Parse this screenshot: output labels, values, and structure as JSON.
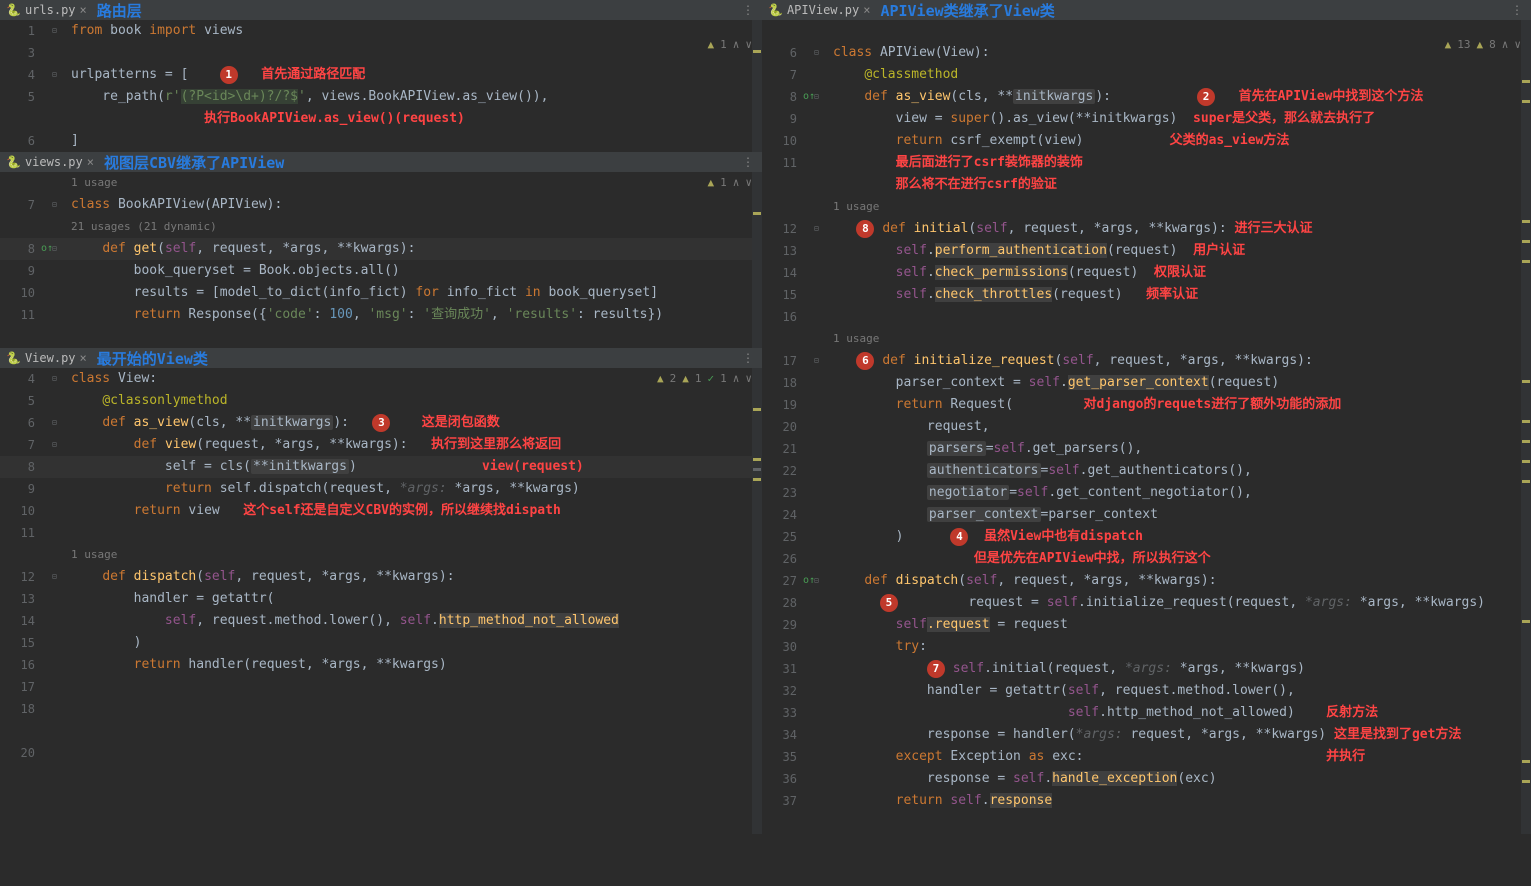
{
  "panes": {
    "urls": {
      "file": "urls.py",
      "title": "路由层",
      "status": "1",
      "lines": {
        "1": [
          {
            "c": "kw",
            "t": "from "
          },
          {
            "c": "",
            "t": "book "
          },
          {
            "c": "kw",
            "t": "import "
          },
          {
            "c": "",
            "t": "views"
          }
        ],
        "4_1": "urlpatterns = [",
        "4_ann": "首先通过路径匹配",
        "5_1": "    re_path(",
        "5_2": "r'",
        "5_3": "(?P<id>\\d+)?/?$",
        "5_4": "'",
        "5_5": ", views.BookAPIView.as_view()),",
        "5_ann": "执行BookAPIView.as_view()(request)",
        "6_1": "]"
      }
    },
    "views": {
      "file": "views.py",
      "title": "视图层CBV继承了APIView",
      "status": "1",
      "usage1": "1 usage",
      "lines": {
        "7": [
          {
            "c": "kw",
            "t": "class "
          },
          {
            "c": "class-name",
            "t": "BookAPIView(APIView):"
          }
        ],
        "usage2": "21 usages (21 dynamic)",
        "8": [
          {
            "c": "",
            "t": "    "
          },
          {
            "c": "kw",
            "t": "def "
          },
          {
            "c": "def",
            "t": "get"
          },
          {
            "c": "",
            "t": "("
          },
          {
            "c": "self",
            "t": "self"
          },
          {
            "c": "",
            "t": ", request, *args, **kwargs):"
          }
        ],
        "9": "        book_queryset = Book.objects.all()",
        "10_1": "        results = [model_to_dict(info_fict) ",
        "10_2": "for ",
        "10_3": "info_fict ",
        "10_4": "in ",
        "10_5": "book_queryset]",
        "11_1": "        ",
        "11_2": "return ",
        "11_3": "Response({",
        "11_4": "'code'",
        "11_5": ": ",
        "11_6": "100",
        "11_7": ", ",
        "11_8": "'msg'",
        "11_9": ": ",
        "11_10": "'查询成功'",
        "11_11": ", ",
        "11_12": "'results'",
        "11_13": ": results})"
      }
    },
    "view": {
      "file": "View.py",
      "title": "最开始的View类",
      "status_warn": "2",
      "status_err": "1",
      "status_chk": "1",
      "lines": {
        "4": [
          {
            "c": "kw",
            "t": "class "
          },
          {
            "c": "class-name",
            "t": "View:"
          }
        ],
        "5": [
          {
            "c": "",
            "t": "    "
          },
          {
            "c": "decorator",
            "t": "@classonlymethod"
          }
        ],
        "6_1": "    ",
        "6_2": "def ",
        "6_3": "as_view",
        "6_4": "(cls, **",
        "6_5": "initkwargs",
        "6_6": "):",
        "6_ann1": "这是闭包函数",
        "6_ann2": "执行到这里那么将返回",
        "6_ann3": "view(request)",
        "7_1": "        ",
        "7_2": "def ",
        "7_3": "view",
        "7_4": "(request, *args, **kwargs):",
        "8_1": "            self = cls(",
        "8_2": "**initkwargs",
        "8_3": ")",
        "9_1": "            ",
        "9_2": "return ",
        "9_3": "self.dispatch(request, ",
        "9_4": "*args: ",
        "9_5": "*args, **kwargs)",
        "10_1": "        ",
        "10_2": "return ",
        "10_3": "view",
        "10_ann": "这个self还是自定义CBV的实例，所以继续找dispath",
        "usage": "1 usage",
        "12_1": "    ",
        "12_2": "def ",
        "12_3": "dispatch",
        "12_4": "(",
        "12_5": "self",
        "12_6": ", request, *args, **kwargs):",
        "13": "        handler = getattr(",
        "14_1": "            ",
        "14_2": "self",
        "14_3": ", request.method.lower(), ",
        "14_4": "self",
        "14_5": ".",
        "14_6": "http_method_not_allowed",
        "15": "        )",
        "16_1": "        ",
        "16_2": "return ",
        "16_3": "handler(request, *args, **kwargs)"
      }
    },
    "apiview": {
      "file": "APIView.py",
      "title": "APIView类继承了View类",
      "status_warn": "13",
      "status_err": "8",
      "usage1": "1 usage",
      "usage2": "1 usage",
      "lines": {
        "6": [
          {
            "c": "kw",
            "t": "class "
          },
          {
            "c": "class-name",
            "t": "APIView(View):"
          }
        ],
        "7": [
          {
            "c": "",
            "t": "    "
          },
          {
            "c": "decorator",
            "t": "@classmethod"
          }
        ],
        "8_1": "    ",
        "8_2": "def ",
        "8_3": "as_view",
        "8_4": "(cls, **",
        "8_5": "initkwargs",
        "8_6": "):",
        "8_ann": "首先在APIView中找到这个方法",
        "9_1": "        view = ",
        "9_2": "super",
        "9_3": "().as_view(**initkwargs)",
        "9_ann1": "super是父类，那么就去执行了",
        "9_ann2": "父类的as_view方法",
        "10_1": "        ",
        "10_2": "return ",
        "10_3": "csrf_exempt(view)",
        "10_ann1": "最后面进行了csrf装饰器的装饰",
        "10_ann2": "那么将不在进行csrf的验证",
        "12_1": "    ",
        "12_2": "def ",
        "12_3": "initial",
        "12_4": "(",
        "12_5": "self",
        "12_6": ", request, *args, **kwargs):",
        "12_ann": "进行三大认证",
        "13_1": "        ",
        "13_2": "self",
        "13_3": ".",
        "13_4": "perform_authentication",
        "13_5": "(request)",
        "13_ann": "用户认证",
        "14_1": "        ",
        "14_2": "self",
        "14_3": ".",
        "14_4": "check_permissions",
        "14_5": "(request)",
        "14_ann": "权限认证",
        "15_1": "        ",
        "15_2": "self",
        "15_3": ".",
        "15_4": "check_throttles",
        "15_5": "(request)",
        "15_ann": "频率认证",
        "17_1": "    ",
        "17_2": "def ",
        "17_3": "initialize_request",
        "17_4": "(",
        "17_5": "self",
        "17_6": ", request, *args, **kwargs):",
        "18_1": "        parser_context = ",
        "18_2": "self",
        "18_3": ".",
        "18_4": "get_parser_context",
        "18_5": "(request)",
        "19_1": "        ",
        "19_2": "return ",
        "19_3": "Request(",
        "19_ann": "对django的requets进行了额外功能的添加",
        "20": "            request,",
        "21_1": "            ",
        "21_2": "parsers",
        "21_3": "=",
        "21_4": "self",
        "21_5": ".get_parsers(),",
        "22_1": "            ",
        "22_2": "authenticators",
        "22_3": "=",
        "22_4": "self",
        "22_5": ".get_authenticators(),",
        "23_1": "            ",
        "23_2": "negotiator",
        "23_3": "=",
        "23_4": "self",
        "23_5": ".get_content_negotiator(),",
        "24_1": "            ",
        "24_2": "parser_context",
        "24_3": "=parser_context",
        "25": "        )",
        "25_ann1": "虽然View中也有dispatch",
        "25_ann2": "但是优先在APIView中找，所以执行这个",
        "27_1": "    ",
        "27_2": "def ",
        "27_3": "dispatch",
        "27_4": "(",
        "27_5": "self",
        "27_6": ", request, *args, **kwargs):",
        "28_1": "        request = ",
        "28_2": "self",
        "28_3": ".initialize_request(request, ",
        "28_4": "*args: ",
        "28_5": "*args, **kwargs)",
        "29_1": "        ",
        "29_2": "self",
        "29_3": ".request",
        "29_4": " = request",
        "30_1": "        ",
        "30_2": "try",
        "30_3": ":",
        "31_1": "            ",
        "31_2": "self",
        "31_3": ".initial(request, ",
        "31_4": "*args: ",
        "31_5": "*args, **kwargs)",
        "32_1": "            handler = getattr(",
        "32_2": "self",
        "32_3": ", request.method.lower(),",
        "33_1": "                              ",
        "33_2": "self",
        "33_3": ".http_method_not_allowed)",
        "33_ann1": "反射方法",
        "33_ann2": "这里是找到了get方法",
        "33_ann3": "并执行",
        "34_1": "            response = handler(",
        "34_2": "*args: ",
        "34_3": "request, *args, **kwargs)",
        "35_1": "        ",
        "35_2": "except ",
        "35_3": "Exception ",
        "35_4": "as ",
        "35_5": "exc:",
        "36_1": "            response = ",
        "36_2": "self",
        "36_3": ".",
        "36_4": "handle_exception",
        "36_5": "(exc)",
        "37_1": "        ",
        "37_2": "return ",
        "37_3": "self",
        "37_4": ".",
        "37_5": "response"
      }
    }
  }
}
